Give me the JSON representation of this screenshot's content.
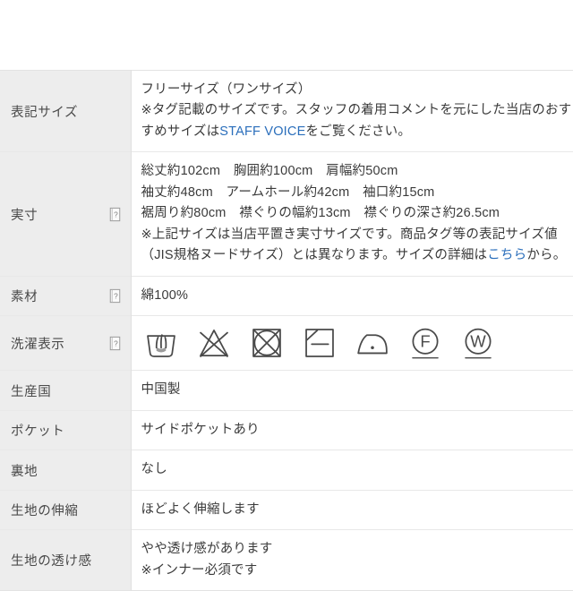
{
  "table": {
    "rows": [
      {
        "id": "display-size",
        "label": "表記サイズ",
        "has_help": false,
        "lines": [
          {
            "text": "フリーサイズ（ワンサイズ）"
          },
          {
            "text": "※タグ記載のサイズです。スタッフの着用コメントを元にした当店のおす"
          },
          {
            "pre": "すめサイズは",
            "link": "STAFF VOICE",
            "post": "をご覧ください。"
          }
        ]
      },
      {
        "id": "actual-measurements",
        "label": "実寸",
        "has_help": true,
        "lines": [
          {
            "text": "総丈約102cm　胸囲約100cm　肩幅約50cm"
          },
          {
            "text": "袖丈約48cm　アームホール約42cm　袖口約15cm"
          },
          {
            "text": "裾周り約80cm　襟ぐりの幅約13cm　襟ぐりの深さ約26.5cm"
          },
          {
            "text": "※上記サイズは当店平置き実寸サイズです。商品タグ等の表記サイズ値"
          },
          {
            "pre": "（JIS規格ヌードサイズ）とは異なります。サイズの詳細は",
            "link": "こちら",
            "post": "から。"
          }
        ]
      },
      {
        "id": "material",
        "label": "素材",
        "has_help": true,
        "lines": [
          {
            "text": "綿100%"
          }
        ]
      },
      {
        "id": "laundry-care",
        "label": "洗濯表示",
        "has_help": true,
        "care_symbols": [
          "hand-wash-tub-icon",
          "no-bleach-icon",
          "no-tumble-dry-icon",
          "flat-dry-in-shade-icon",
          "iron-low-heat-icon",
          "dry-clean-f-icon",
          "wet-clean-w-icon"
        ]
      },
      {
        "id": "country-of-origin",
        "label": "生産国",
        "has_help": false,
        "lines": [
          {
            "text": "中国製"
          }
        ]
      },
      {
        "id": "pocket",
        "label": "ポケット",
        "has_help": false,
        "lines": [
          {
            "text": "サイドポケットあり"
          }
        ]
      },
      {
        "id": "lining",
        "label": "裏地",
        "has_help": false,
        "lines": [
          {
            "text": "なし"
          }
        ]
      },
      {
        "id": "fabric-stretch",
        "label": "生地の伸縮",
        "has_help": false,
        "lines": [
          {
            "text": "ほどよく伸縮します"
          }
        ]
      },
      {
        "id": "fabric-sheerness",
        "label": "生地の透け感",
        "has_help": false,
        "lines": [
          {
            "text": "やや透け感があります"
          },
          {
            "text": "※インナー必須です"
          }
        ]
      }
    ]
  },
  "colors": {
    "label_background": "#ededed",
    "value_background": "#ffffff",
    "border": "#e8e8e8",
    "link": "#2a6ebb",
    "text": "#3a3a3a",
    "symbol_stroke": "#4a4a4a"
  }
}
